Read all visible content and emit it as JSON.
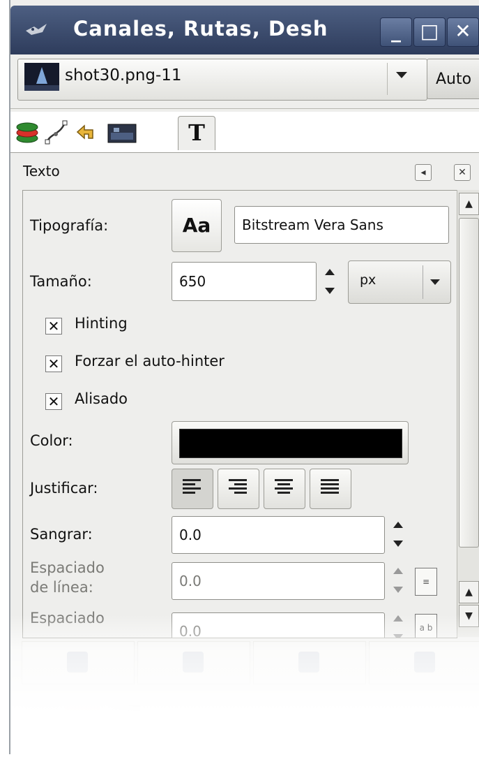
{
  "window": {
    "title": "Canales, Rutas, Desh",
    "minimize_glyph": "_",
    "maximize_glyph": "□",
    "close_glyph": "✕"
  },
  "image_selector": {
    "value": "shot30.png-11",
    "auto_label": "Auto"
  },
  "tabs": [
    {
      "icon": "layers-icon"
    },
    {
      "icon": "paths-icon"
    },
    {
      "icon": "undo-history-icon"
    },
    {
      "icon": "images-icon"
    },
    {
      "icon": "text-tool-icon",
      "label": "T",
      "active": true
    }
  ],
  "dock": {
    "title": "Texto"
  },
  "text_options": {
    "font_label": "Tipografía:",
    "font_preview": "Aa",
    "font_value": "Bitstream Vera Sans",
    "size_label": "Tamaño:",
    "size_value": "650",
    "unit_value": "px",
    "hinting_label": "Hinting",
    "hinting_checked": true,
    "autohint_label": "Forzar el auto-hinter",
    "autohint_checked": true,
    "antialias_label": "Alisado",
    "antialias_checked": true,
    "check_glyph": "✕",
    "color_label": "Color:",
    "color_value": "#000000",
    "justify_label": "Justificar:",
    "indent_label": "Sangrar:",
    "indent_value": "0.0",
    "line_spacing_label_1": "Espaciado",
    "line_spacing_label_2": "de línea:",
    "line_spacing_value": "0.0",
    "letter_spacing_label": "Espaciado",
    "letter_spacing_value": "0.0"
  }
}
